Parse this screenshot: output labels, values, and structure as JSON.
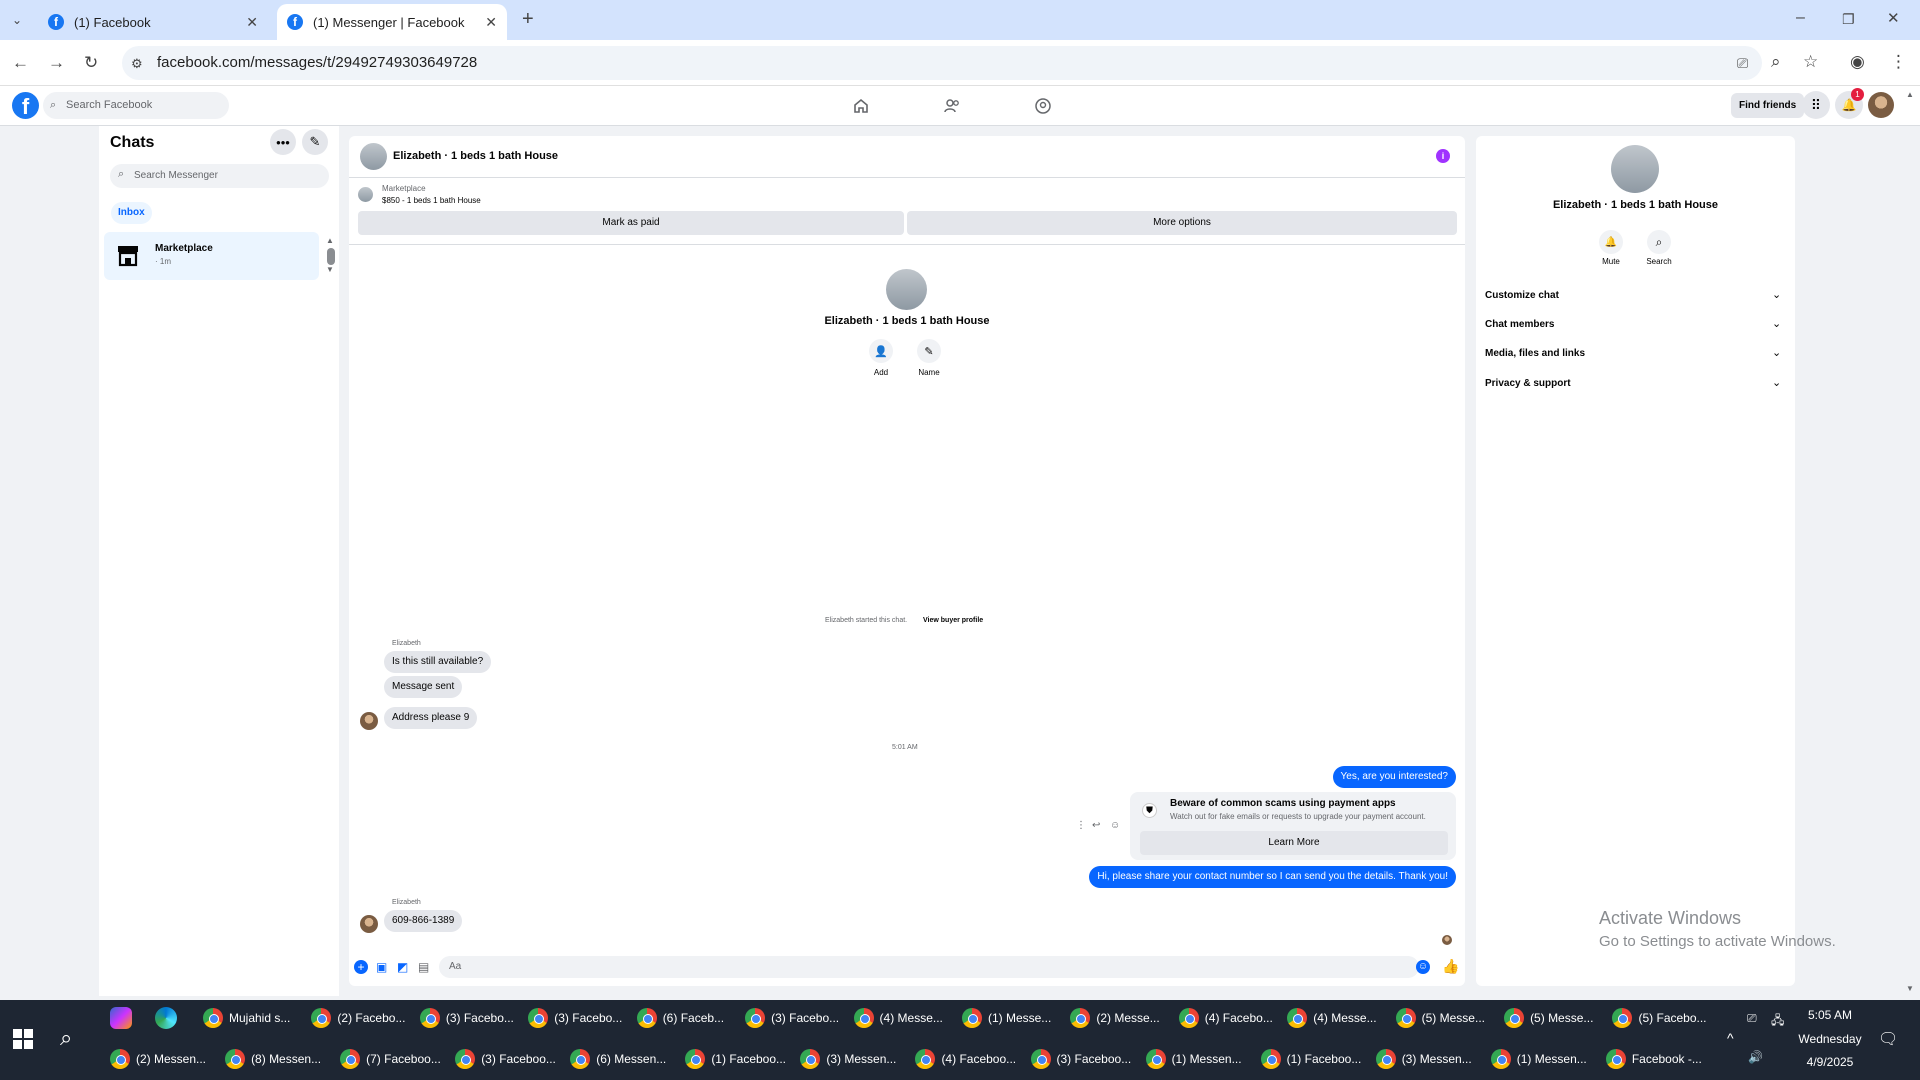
{
  "browser": {
    "tabs": [
      {
        "title": "(1) Facebook"
      },
      {
        "title": "(1) Messenger | Facebook"
      }
    ],
    "url": "facebook.com/messages/t/29492749303649728"
  },
  "fb": {
    "search_placeholder": "Search Facebook",
    "find_friends": "Find friends",
    "notif_count": "1"
  },
  "left": {
    "title": "Chats",
    "search_placeholder": "Search Messenger",
    "inbox_label": "Inbox",
    "chat": {
      "name": "Marketplace",
      "time": "· 1m"
    }
  },
  "center": {
    "header_title": "Elizabeth · 1 beds 1 bath House",
    "listing_label": "Marketplace",
    "listing_title": "$850 - 1 beds 1 bath House",
    "mark_paid": "Mark as paid",
    "more_options": "More options",
    "profile_name": "Elizabeth · 1 beds 1 bath House",
    "add_label": "Add",
    "name_label": "Name",
    "started_text": "Elizabeth started this chat.",
    "view_profile": "View buyer profile",
    "sender_name": "Elizabeth",
    "msg1": "Is this still available?",
    "msg2": "Message sent",
    "msg3": "Address please 9",
    "timestamp": "5:01 AM",
    "my_msg1": "Yes, are you interested?",
    "scam_title": "Beware of common scams using payment apps",
    "scam_body": "Watch out for fake emails or requests to upgrade your payment account.",
    "learn_more": "Learn More",
    "my_msg2": "Hi, please share your contact number so I can send you the details. Thank you!",
    "sender_name2": "Elizabeth",
    "msg4": "609-866-1389",
    "composer_placeholder": "Aa"
  },
  "right": {
    "name": "Elizabeth · 1 beds 1 bath House",
    "mute": "Mute",
    "search": "Search",
    "sections": [
      "Customize chat",
      "Chat members",
      "Media, files and links",
      "Privacy & support"
    ]
  },
  "watermark": {
    "line1": "Activate Windows",
    "line2": "Go to Settings to activate Windows."
  },
  "taskbar": {
    "row1": [
      "Mujahid s...",
      "(2) Facebo...",
      "(3) Facebo...",
      "(3) Facebo...",
      "(6) Faceb...",
      "(3) Facebo...",
      "(4) Messe...",
      "(1) Messe...",
      "(2) Messe...",
      "(4) Facebo...",
      "(4) Messe...",
      "(5) Messe...",
      "(5) Messe...",
      "(5) Facebo..."
    ],
    "row2": [
      "(2) Messen...",
      "(8) Messen...",
      "(7) Faceboo...",
      "(3) Faceboo...",
      "(6) Messen...",
      "(1) Faceboo...",
      "(3) Messen...",
      "(4) Faceboo...",
      "(3) Faceboo...",
      "(1) Messen...",
      "(1) Faceboo...",
      "(3) Messen...",
      "(1) Messen...",
      "Facebook -..."
    ],
    "time": "5:05 AM",
    "day": "Wednesday",
    "date": "4/9/2025"
  }
}
